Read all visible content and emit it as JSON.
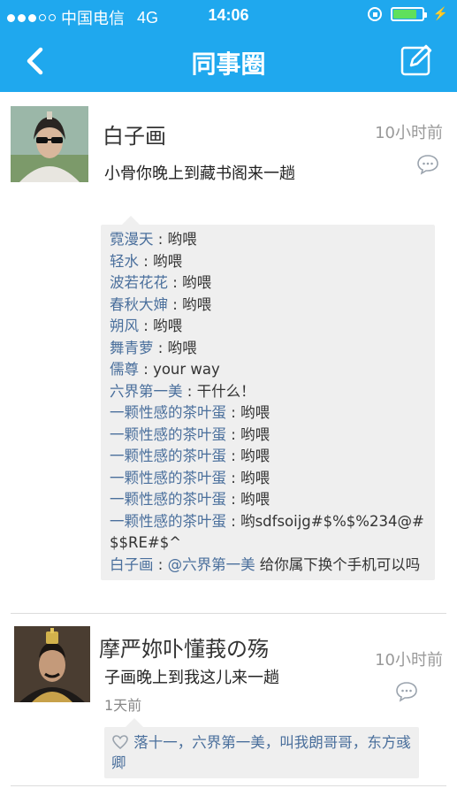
{
  "status": {
    "carrier": "中国电信",
    "network": "4G",
    "time": "14:06"
  },
  "nav": {
    "title": "同事圈"
  },
  "posts": [
    {
      "name": "白子画",
      "time": "10小时前",
      "text": "小骨你晚上到藏书阁来一趟",
      "comments": [
        {
          "name": "霓漫天",
          "sep": " : ",
          "text": "哟喂"
        },
        {
          "name": "轻水",
          "sep": " : ",
          "text": "哟喂"
        },
        {
          "name": "波若花花",
          "sep": " : ",
          "text": "哟喂"
        },
        {
          "name": "春秋大婶",
          "sep": " : ",
          "text": "哟喂"
        },
        {
          "name": "朔风",
          "sep": " : ",
          "text": "哟喂"
        },
        {
          "name": "舞青萝",
          "sep": " : ",
          "text": "哟喂"
        },
        {
          "name": "儒尊",
          "sep": " : ",
          "text": "your way"
        },
        {
          "name": "六界第一美",
          "sep": " : ",
          "text": "干什么！"
        },
        {
          "name": "一颗性感的茶叶蛋",
          "sep": " : ",
          "text": "哟喂"
        },
        {
          "name": "一颗性感的茶叶蛋",
          "sep": " : ",
          "text": "哟喂"
        },
        {
          "name": "一颗性感的茶叶蛋",
          "sep": " : ",
          "text": "哟喂"
        },
        {
          "name": "一颗性感的茶叶蛋",
          "sep": " : ",
          "text": "哟喂"
        },
        {
          "name": "一颗性感的茶叶蛋",
          "sep": " : ",
          "text": "哟喂"
        },
        {
          "name": "一颗性感的茶叶蛋",
          "sep": " : ",
          "text": "哟sdfsoijg#$%$%234@#$$RE#$^"
        },
        {
          "name": "白子画",
          "sep": " : ",
          "mention": "@六界第一美",
          "text": " 给你属下换个手机可以吗"
        }
      ]
    },
    {
      "name": "摩严妳卟懂莪の殇",
      "time": "10小时前",
      "text": "子画晚上到我这儿来一趟",
      "subtime": "1天前",
      "likes": "落十一，六界第一美，叫我朗哥哥，东方彧卿"
    }
  ],
  "icons": {
    "back": "chevron-left-icon",
    "edit": "edit-icon",
    "comment": "comment-bubble-icon",
    "like": "heart-icon"
  },
  "colors": {
    "accent": "#1fa8ee",
    "link": "#4a6f9c"
  }
}
